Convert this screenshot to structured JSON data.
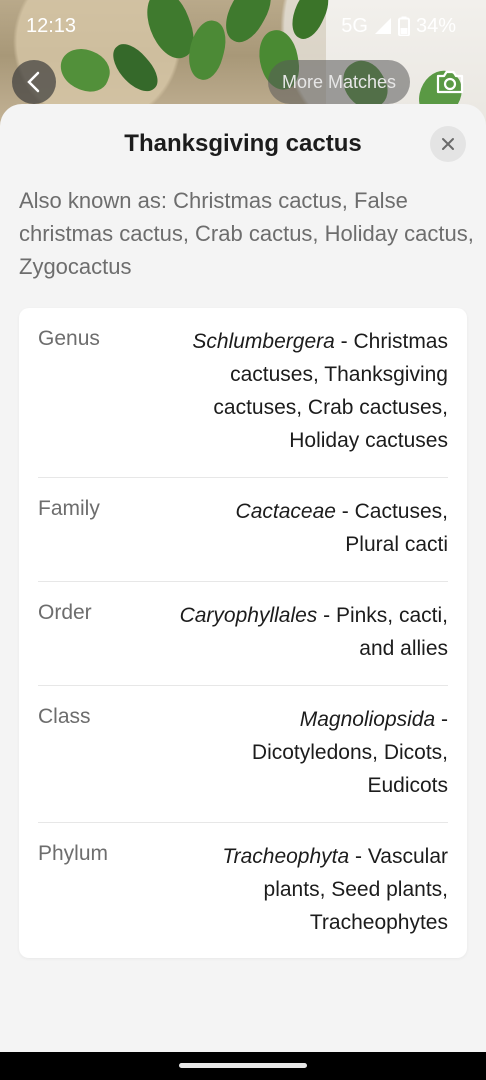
{
  "status_bar": {
    "time": "12:13",
    "network": "5G",
    "battery": "34%"
  },
  "header": {
    "more_matches_label": "More Matches",
    "back_icon": "chevron-left-icon",
    "camera_icon": "camera-icon"
  },
  "sheet": {
    "title": "Thanksgiving cactus",
    "close_icon": "close-icon",
    "also_known_as": "Also known as: Christmas cactus, False christmas cactus, Crab cactus, Holiday cactus, Zygocactus"
  },
  "taxonomy": [
    {
      "rank": "Genus",
      "scientific": "Schlumbergera",
      "common": " - Christmas cactuses, Thanksgiving cactuses, Crab cactuses, Holiday cactuses"
    },
    {
      "rank": "Family",
      "scientific": "Cactaceae",
      "common": " - Cactuses, Plural cacti"
    },
    {
      "rank": "Order",
      "scientific": "Caryophyllales",
      "common": " - Pinks, cacti, and allies"
    },
    {
      "rank": "Class",
      "scientific": "Magnoliopsida",
      "common": " - Dicotyledons, Dicots, Eudicots"
    },
    {
      "rank": "Phylum",
      "scientific": "Tracheophyta",
      "common": " - Vascular plants, Seed plants, Tracheophytes"
    }
  ]
}
